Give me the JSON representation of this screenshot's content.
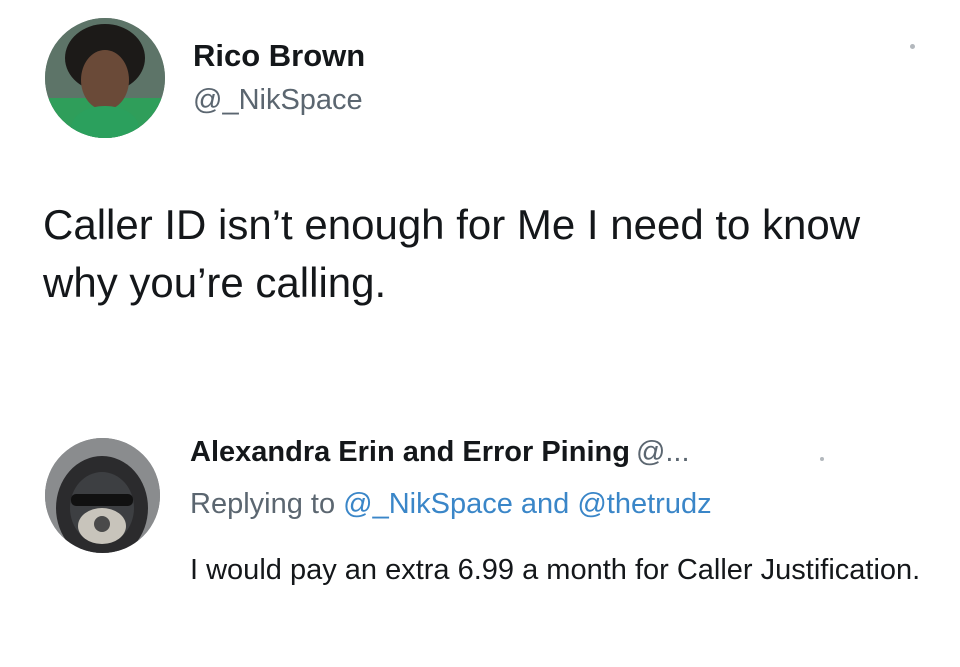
{
  "tweet": {
    "author": {
      "name": "Rico Brown",
      "handle": "@_NikSpace"
    },
    "text": "Caller ID isn’t enough for Me I need to know why you’re calling."
  },
  "reply": {
    "author": {
      "name": "Alexandra Erin and Error Pining",
      "handle": "@..."
    },
    "replying_prefix": "Replying to",
    "replying_mention_1": "@_NikSpace",
    "replying_joiner": "and",
    "replying_mention_2": "@thetrudz",
    "text": "I would pay an extra 6.99 a month for Caller Justification."
  },
  "colors": {
    "handle_gray": "#5b6670",
    "mention_blue": "#3a86c8",
    "text_black": "#14171a"
  }
}
